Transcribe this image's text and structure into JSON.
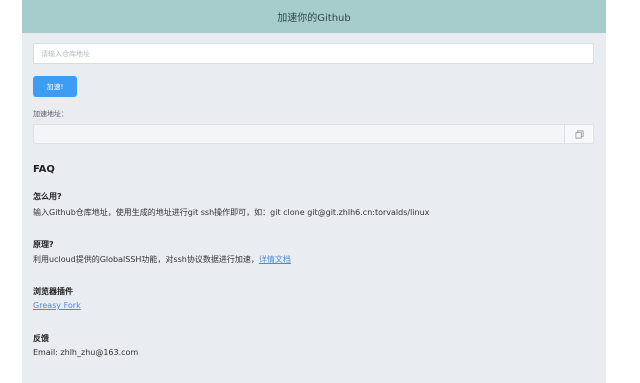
{
  "header": {
    "title": "加速你的Github"
  },
  "repo_input": {
    "placeholder": "请输入仓库地址",
    "value": ""
  },
  "accelerate_button": {
    "label": "加速!"
  },
  "address": {
    "label": "加速地址：",
    "value": ""
  },
  "copy_icon": "copy-icon",
  "faq": {
    "title": "FAQ",
    "items": [
      {
        "question": "怎么用?",
        "answer": "输入Github仓库地址，使用生成的地址进行git ssh操作即可，如：git clone git@git.zhlh6.cn:torvalds/linux"
      },
      {
        "question": "原理?",
        "answer": "利用ucloud提供的GlobalSSH功能，对ssh协议数据进行加速，",
        "link": "详情文档"
      },
      {
        "question": "浏览器插件",
        "link": "Greasy Fork"
      },
      {
        "question": "反馈",
        "answer": "Email: zhlh_zhu@163.com"
      }
    ]
  },
  "colors": {
    "header_bg": "#a7cccc",
    "button_bg": "#3d9df2",
    "page_bg": "#e9ecf1",
    "link": "#4a8fd6"
  }
}
